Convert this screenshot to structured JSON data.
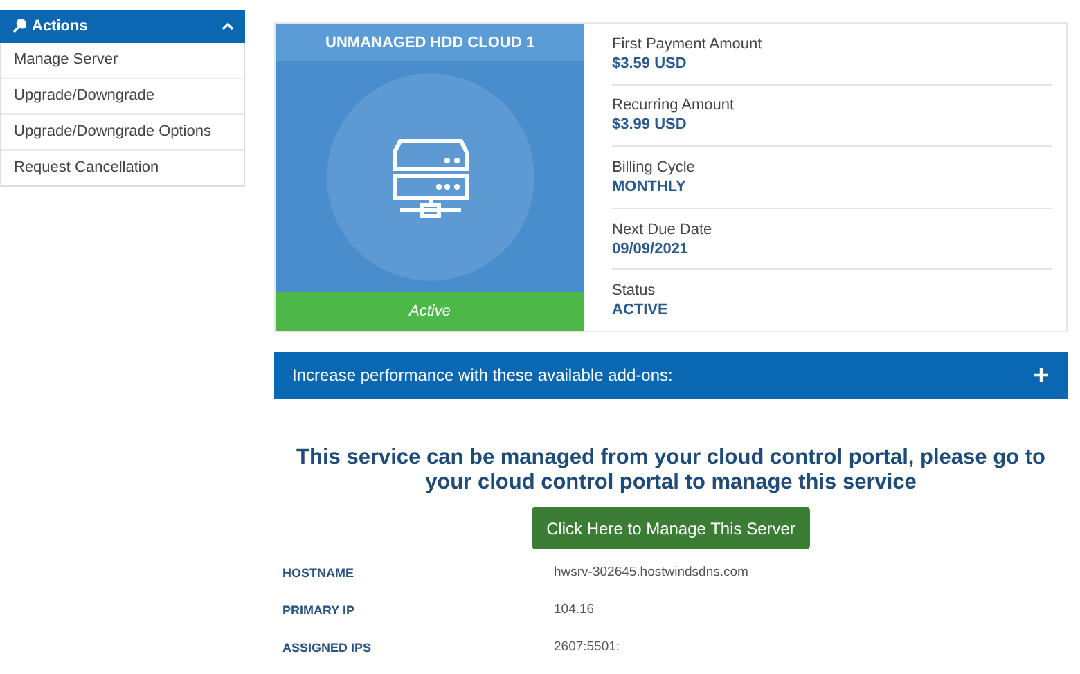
{
  "sidebar": {
    "title": "Actions",
    "expanded": true,
    "items": [
      {
        "label": "Manage Server"
      },
      {
        "label": "Upgrade/Downgrade"
      },
      {
        "label": "Upgrade/Downgrade Options"
      },
      {
        "label": "Request Cancellation"
      }
    ]
  },
  "product": {
    "name": "UNMANAGED HDD CLOUD 1",
    "status_label": "Active"
  },
  "details": [
    {
      "label": "First Payment Amount",
      "value": "$3.59 USD"
    },
    {
      "label": "Recurring Amount",
      "value": "$3.99 USD"
    },
    {
      "label": "Billing Cycle",
      "value": "MONTHLY"
    },
    {
      "label": "Next Due Date",
      "value": "09/09/2021"
    },
    {
      "label": "Status",
      "value": "ACTIVE"
    }
  ],
  "addons": {
    "title": "Increase performance with these available add-ons:",
    "expanded": false
  },
  "notice": "This service can be managed from your cloud control portal, please go to your cloud control portal to manage this service",
  "manage_button": "Click Here to Manage This Server",
  "info": [
    {
      "label": "HOSTNAME",
      "value": "hwsrv-302645.hostwindsdns.com"
    },
    {
      "label": "PRIMARY IP",
      "value": "104.16"
    },
    {
      "label": "ASSIGNED IPS",
      "value": "2607:5501:"
    }
  ]
}
